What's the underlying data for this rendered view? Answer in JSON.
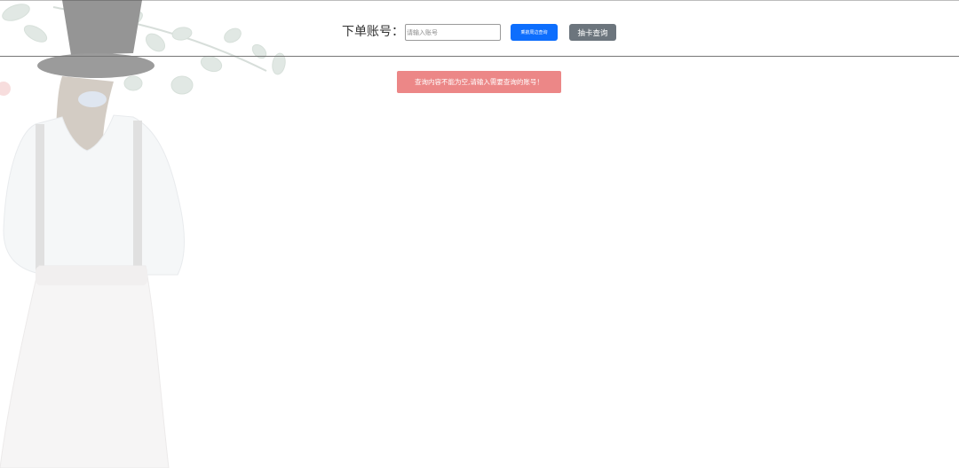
{
  "query": {
    "label": "下单账号：",
    "account_input": {
      "value": "",
      "placeholder": "请输入账号"
    },
    "nearby_query_button": "乘航周边查询",
    "card_query_button": "抽卡查询"
  },
  "alert": {
    "message": "查询内容不能为空,请输入需要查询的账号！"
  },
  "colors": {
    "primary": "#0d6efd",
    "secondary": "#6c757d",
    "danger_alert": "#ec8787",
    "divider": "#777777"
  }
}
